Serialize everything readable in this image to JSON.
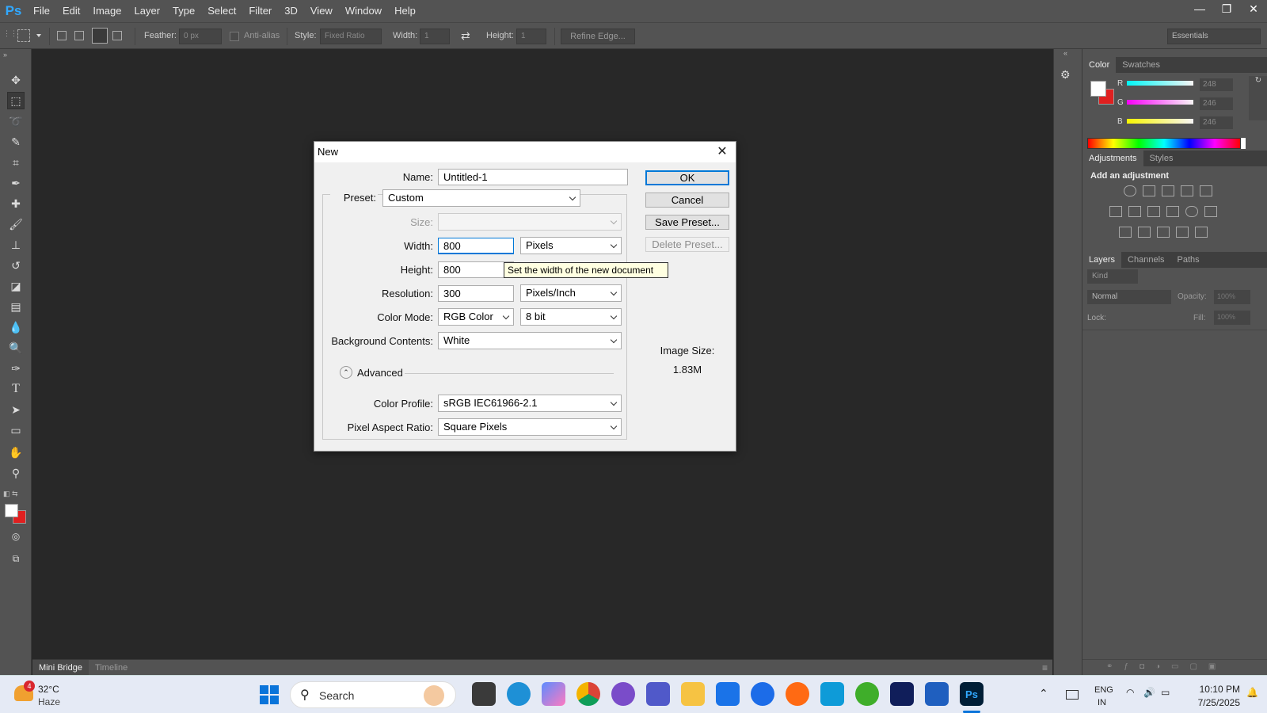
{
  "app": {
    "logo": "Ps"
  },
  "menu": [
    "File",
    "Edit",
    "Image",
    "Layer",
    "Type",
    "Select",
    "Filter",
    "3D",
    "View",
    "Window",
    "Help"
  ],
  "window_controls": {
    "minimize": "—",
    "restore": "❐",
    "close": "✕"
  },
  "options_bar": {
    "feather_label": "Feather:",
    "feather_value": "0 px",
    "antialias_label": "Anti-alias",
    "style_label": "Style:",
    "style_value": "Fixed Ratio",
    "width_label": "Width:",
    "width_value": "1",
    "height_label": "Height:",
    "height_value": "1",
    "refine_edge": "Refine Edge...",
    "workspace": "Essentials"
  },
  "bottom_tabs": [
    "Mini Bridge",
    "Timeline"
  ],
  "color_panel": {
    "tabs": [
      "Color",
      "Swatches"
    ],
    "r_label": "R",
    "g_label": "G",
    "b_label": "B",
    "r": "248",
    "g": "246",
    "b": "246"
  },
  "adjustments_panel": {
    "tabs": [
      "Adjustments",
      "Styles"
    ],
    "heading": "Add an adjustment"
  },
  "layers_panel": {
    "tabs": [
      "Layers",
      "Channels",
      "Paths"
    ],
    "kind": "Kind",
    "blend_mode": "Normal",
    "opacity_label": "Opacity:",
    "opacity_value": "100%",
    "lock_label": "Lock:",
    "fill_label": "Fill:",
    "fill_value": "100%"
  },
  "dialog": {
    "title": "New",
    "name_label": "Name:",
    "name_value": "Untitled-1",
    "preset_label": "Preset:",
    "preset_value": "Custom",
    "size_label": "Size:",
    "width_label": "Width:",
    "width_value": "800",
    "width_unit": "Pixels",
    "height_label": "Height:",
    "height_value": "800",
    "resolution_label": "Resolution:",
    "resolution_value": "300",
    "resolution_unit": "Pixels/Inch",
    "color_mode_label": "Color Mode:",
    "color_mode_value": "RGB Color",
    "bit_depth": "8 bit",
    "background_label": "Background Contents:",
    "background_value": "White",
    "advanced_label": "Advanced",
    "profile_label": "Color Profile:",
    "profile_value": "sRGB IEC61966-2.1",
    "aspect_label": "Pixel Aspect Ratio:",
    "aspect_value": "Square Pixels",
    "ok": "OK",
    "cancel": "Cancel",
    "save_preset": "Save Preset...",
    "delete_preset": "Delete Preset...",
    "image_size_label": "Image Size:",
    "image_size_value": "1.83M",
    "tooltip": "Set the width of the new document"
  },
  "taskbar": {
    "weather_temp": "32°C",
    "weather_desc": "Haze",
    "weather_badge": "4",
    "search_placeholder": "Search",
    "lang1": "ENG",
    "lang2": "IN",
    "time": "10:10 PM",
    "date": "7/25/2025"
  },
  "colors": {
    "accent": "#0078d7",
    "ps_blue": "#31a8ff",
    "fg_swatch": "#ffffff",
    "bg_swatch": "#e02020"
  }
}
